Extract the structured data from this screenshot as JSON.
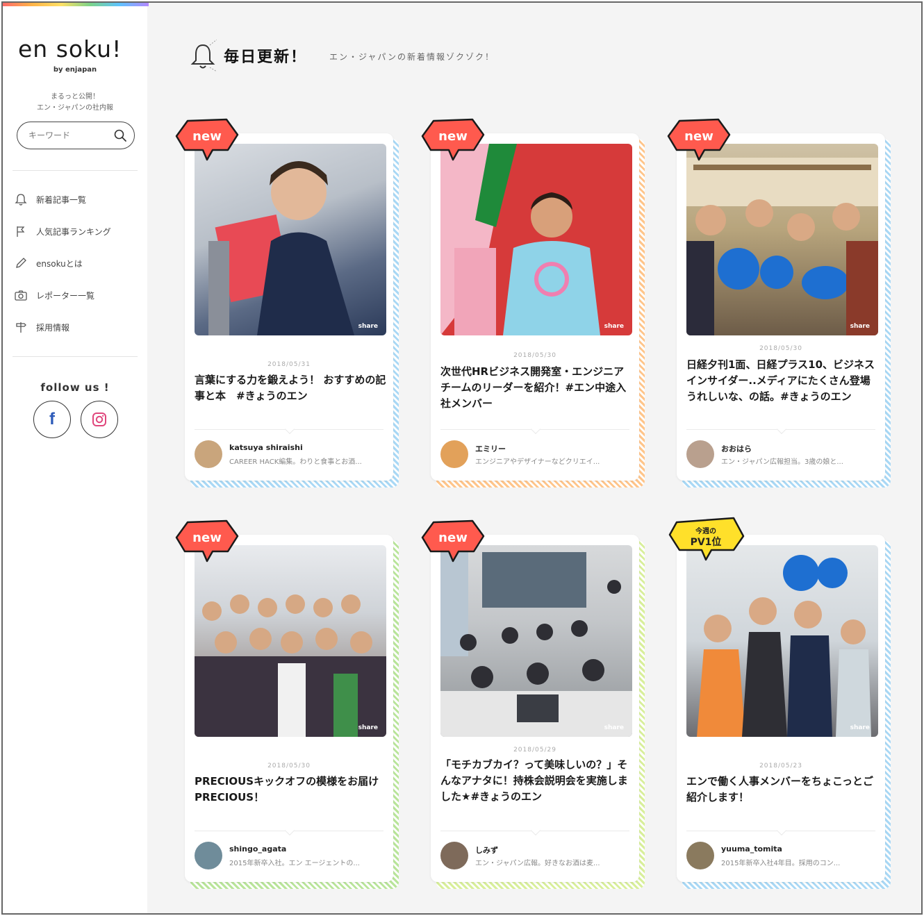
{
  "sidebar": {
    "logo": "en soku!",
    "logo_sub": "by enjapan",
    "tagline_1": "まるっと公開！",
    "tagline_2": "エン・ジャパンの社内報",
    "search_placeholder": "キーワード",
    "nav": [
      {
        "label": "新着記事一覧",
        "icon": "bell-icon"
      },
      {
        "label": "人気記事ランキング",
        "icon": "flag-icon"
      },
      {
        "label": "ensokuとは",
        "icon": "pencil-icon"
      },
      {
        "label": "レポーター一覧",
        "icon": "camera-icon"
      },
      {
        "label": "採用情報",
        "icon": "signpost-icon"
      }
    ],
    "follow_label": "follow us !",
    "social": [
      {
        "name": "facebook",
        "glyph": "f"
      },
      {
        "name": "instagram",
        "glyph": ""
      }
    ]
  },
  "header": {
    "title": "毎日更新！",
    "subtitle": "エン・ジャパンの新着情報ゾクゾク！"
  },
  "badges": {
    "new": "new",
    "pv_top": "今週の",
    "pv_bottom": "PV1位"
  },
  "share_label": "share",
  "cards": [
    {
      "date": "2018/05/31",
      "title": "言葉にする力を鍛えよう！ おすすめの記事と本　#きょうのエン",
      "author": "katsuya shiraishi",
      "author_desc": "CAREER HACK編集。わりと食事とお酒...",
      "badge": "new",
      "stripe": "#a9d8f5"
    },
    {
      "date": "2018/05/30",
      "title": "次世代HRビジネス開発室・エンジニアチームのリーダーを紹介！#エン中途入社メンバー",
      "author": "エミリー",
      "author_desc": "エンジニアやデザイナーなどクリエイ...",
      "badge": "new",
      "stripe": "#ffc58a"
    },
    {
      "date": "2018/05/30",
      "title": "日経夕刊1面、日経プラス10、ビジネスインサイダー..メディアにたくさん登場うれしいな、の話。#きょうのエン",
      "author": "おおはら",
      "author_desc": "エン・ジャパン広報担当。3歳の娘と...",
      "badge": "new",
      "stripe": "#a9d8f5"
    },
    {
      "date": "2018/05/30",
      "title": "PRECIOUSキックオフの模様をお届けPRECIOUS！",
      "author": "shingo_agata",
      "author_desc": "2015年新卒入社。エン エージェントの...",
      "badge": "new",
      "stripe": "#b9e59a"
    },
    {
      "date": "2018/05/29",
      "title": "「モチカブカイ？って美味しいの？」そんなアナタに！持株会説明会を実施しました★#きょうのエン",
      "author": "しみず",
      "author_desc": "エン・ジャパン広報。好きなお酒は麦...",
      "badge": "new",
      "stripe": "#d8ef9a"
    },
    {
      "date": "2018/05/23",
      "title": "エンで働く人事メンバーをちょこっとご紹介します！",
      "author": "yuuma_tomita",
      "author_desc": "2015年新卒入社4年目。採用のコン...",
      "badge": "pv",
      "stripe": "#a9d8f5"
    }
  ],
  "colors": {
    "new_badge": "#ff5a4e",
    "pv_badge": "#ffe02a",
    "accent_blue": "#a9d8f5",
    "accent_orange": "#ffc58a",
    "accent_green": "#b9e59a"
  }
}
